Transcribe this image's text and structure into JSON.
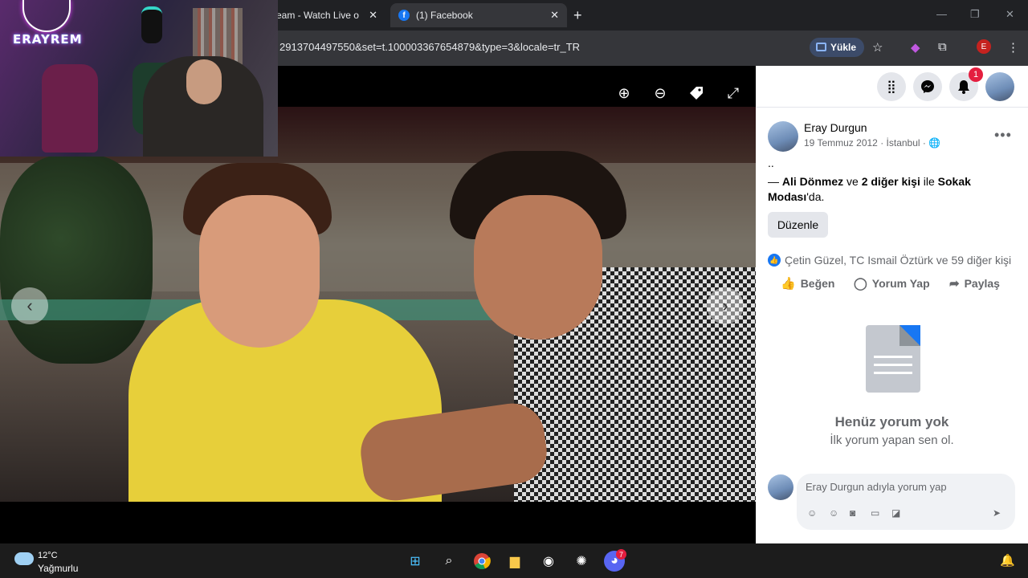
{
  "browser": {
    "tabs": [
      {
        "label": "ream - Watch Live o",
        "active": false
      },
      {
        "label": "(1) Facebook",
        "active": true
      }
    ],
    "url": "2913704497550&set=t.100003367654879&type=3&locale=tr_TR",
    "upload_label": "Yükle",
    "profile_initial": "E",
    "new_tab": "+",
    "window_controls": [
      "—",
      "❐",
      "✕"
    ]
  },
  "stream_overlay": {
    "brand": "ERAYREM"
  },
  "photo_viewer": {
    "controls": [
      "zoom-in",
      "zoom-out",
      "tag",
      "fullscreen"
    ],
    "prev_glyph": "‹",
    "next_glyph": "›"
  },
  "facebook": {
    "notifications_count": "1",
    "post": {
      "author": "Eray Durgun",
      "date": "19 Temmuz 2012",
      "location": "İstanbul",
      "caption": "..",
      "tagline_prefix": "— ",
      "tagged_person": "Ali Dönmez",
      "tagline_and": " ve ",
      "tagged_others": "2 diğer kişi",
      "tagline_with": " ile ",
      "place": "Sokak Modası",
      "place_suffix": "'da.",
      "edit_label": "Düzenle",
      "likes_text": "Çetin Güzel, TC Ismail Öztürk ve 59 diğer kişi",
      "actions": {
        "like": "Beğen",
        "comment": "Yorum Yap",
        "share": "Paylaş"
      }
    },
    "comments_empty": {
      "title": "Henüz yorum yok",
      "subtitle": "İlk yorum yapan sen ol."
    },
    "comment_input": {
      "placeholder": "Eray Durgun adıyla yorum yap"
    }
  },
  "taskbar": {
    "temperature": "12°C",
    "condition": "Yağmurlu",
    "discord_badge": "7"
  }
}
